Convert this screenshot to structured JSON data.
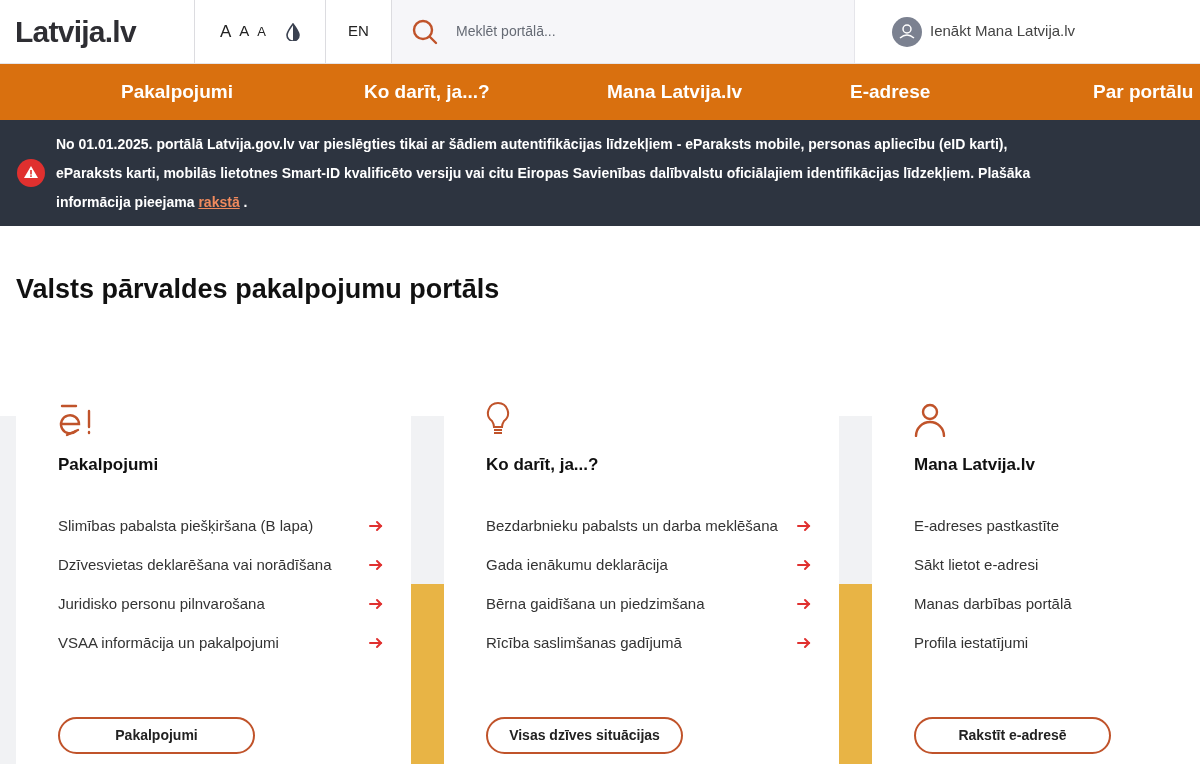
{
  "header": {
    "logo": "Latvija.lv",
    "text_sizes": [
      "A",
      "A",
      "A"
    ],
    "language": "EN",
    "search": {
      "placeholder": "Meklēt portālā..."
    },
    "login": "Ienākt Mana Latvija.lv"
  },
  "nav": {
    "items": [
      "Pakalpojumi",
      "Ko darīt, ja...?",
      "Mana Latvija.lv",
      "E-adrese",
      "Par portālu"
    ]
  },
  "alert": {
    "text_before": "No 01.01.2025. portālā Latvija.gov.lv var pieslēgties tikai ar šādiem autentifikācijas līdzekļiem - eParaksts mobile, personas apliecību (eID karti), eParaksts karti, mobilās lietotnes Smart-ID kvalificēto versiju vai citu Eiropas Savienības dalībvalstu oficiālajiem identifikācijas līdzekļiem. Plašāka informācija pieejama ",
    "link": "rakstā",
    "text_after": " ."
  },
  "heading": "Valsts pārvaldes pakalpojumu portāls",
  "cards": [
    {
      "kind": "e-sign",
      "title": "Pakalpojumi",
      "items": [
        {
          "label": "Slimības pabalsta piešķiršana (B lapa)",
          "arrow": true
        },
        {
          "label": "Dzīvesvietas deklarēšana vai norādīšana",
          "arrow": true
        },
        {
          "label": "Juridisko personu pilnvarošana",
          "arrow": true
        },
        {
          "label": "VSAA informācija un pakalpojumi",
          "arrow": true
        }
      ],
      "button": "Pakalpojumi"
    },
    {
      "kind": "bulb",
      "title": "Ko darīt, ja...?",
      "items": [
        {
          "label": "Bezdarbnieku pabalsts un darba meklēšana",
          "arrow": true
        },
        {
          "label": "Gada ienākumu deklarācija",
          "arrow": true
        },
        {
          "label": "Bērna gaidīšana un piedzimšana",
          "arrow": true
        },
        {
          "label": "Rīcība saslimšanas gadījumā",
          "arrow": true
        }
      ],
      "button": "Visas dzīves situācijas"
    },
    {
      "kind": "user",
      "title": "Mana Latvija.lv",
      "items": [
        {
          "label": "E-adreses pastkastīte",
          "arrow": false
        },
        {
          "label": "Sākt lietot e-adresi",
          "arrow": false
        },
        {
          "label": "Manas darbības portālā",
          "arrow": false
        },
        {
          "label": "Profila iestatījumi",
          "arrow": false
        }
      ],
      "button": "Rakstīt e-adresē"
    }
  ]
}
